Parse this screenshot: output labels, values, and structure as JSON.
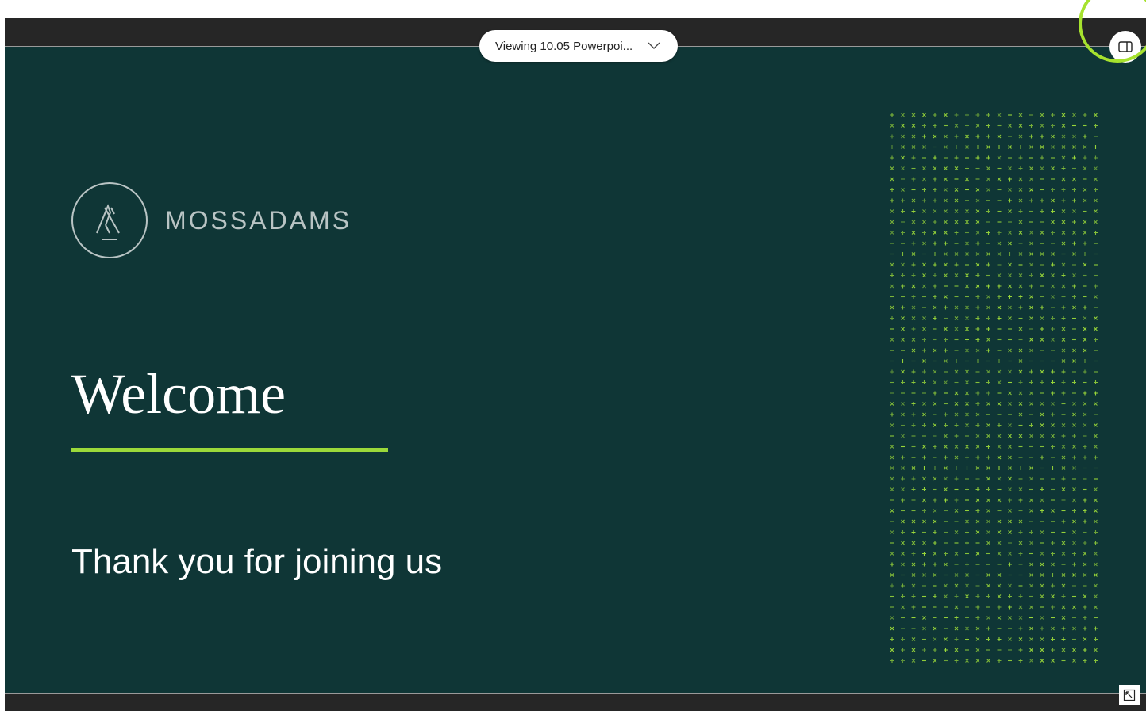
{
  "header": {
    "viewing_label": "Viewing 10.05 Powerpoi...",
    "chevron_icon": "chevron-down-icon",
    "panel_icon": "side-panel-icon"
  },
  "slide": {
    "logo_text": "MOSSADAMS",
    "logo_icon": "moss-adams-mountain-logo",
    "title": "Welcome",
    "subtitle": "Thank you for joining us",
    "pattern": "green-cross-pattern"
  },
  "footer": {
    "expand_icon": "expand-arrow-icon"
  },
  "colors": {
    "slide_background": "#0f3636",
    "accent": "#9bd93a",
    "highlight_ring": "#a6e22e",
    "logo_gray": "#b9c4c4",
    "bar_background": "#262626"
  }
}
